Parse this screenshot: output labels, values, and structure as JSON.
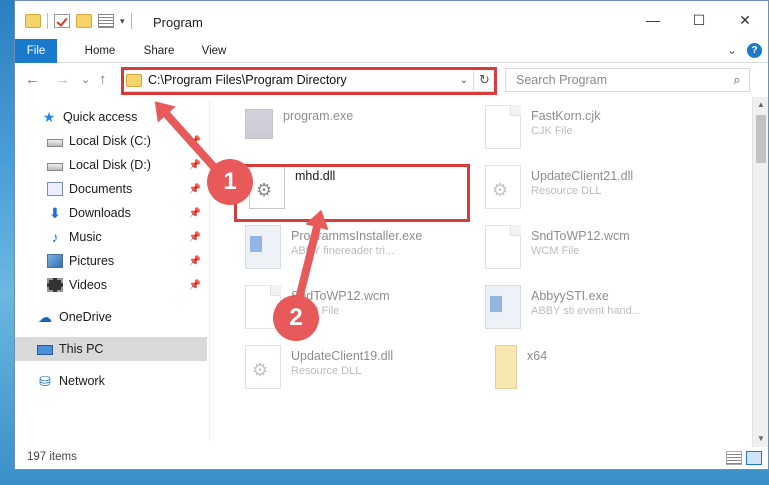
{
  "window": {
    "title": "Program",
    "minimize": "—",
    "maximize": "☐",
    "close": "✕"
  },
  "qat": {
    "dropdown": "▾"
  },
  "ribbon": {
    "tabs": [
      "File",
      "Home",
      "Share",
      "View"
    ],
    "expand": "⌄",
    "help": "?"
  },
  "nav": {
    "back": "←",
    "forward": "→",
    "recent": "⌄",
    "up": "↑",
    "address": "C:\\Program Files\\Program Directory",
    "address_dropdown": "⌄",
    "refresh": "↻",
    "search_placeholder": "Search Program",
    "search_icon": "⌕"
  },
  "sidebar": {
    "pin_glyph": "📌",
    "items": [
      {
        "label": "Quick access",
        "icon": "star-icon"
      },
      {
        "label": "Local Disk (C:)",
        "icon": "drive-icon"
      },
      {
        "label": "Local Disk (D:)",
        "icon": "drive-icon"
      },
      {
        "label": "Documents",
        "icon": "documents-icon"
      },
      {
        "label": "Downloads",
        "icon": "download-icon"
      },
      {
        "label": "Music",
        "icon": "music-icon"
      },
      {
        "label": "Pictures",
        "icon": "pictures-icon"
      },
      {
        "label": "Videos",
        "icon": "videos-icon"
      },
      {
        "label": "OneDrive",
        "icon": "cloud-icon"
      },
      {
        "label": "This PC",
        "icon": "computer-icon"
      },
      {
        "label": "Network",
        "icon": "network-icon"
      }
    ],
    "glyphs": {
      "star": "★",
      "down": "⬇",
      "music": "♪",
      "cloud": "☁",
      "net": "⛁"
    }
  },
  "files": [
    {
      "name": "program.exe",
      "type": ""
    },
    {
      "name": "FastKorn.cjk",
      "type": "CJK File"
    },
    {
      "name": "mhd.dll",
      "type": ""
    },
    {
      "name": "UpdateClient21.dll",
      "type": "Resource DLL"
    },
    {
      "name": "ProgrammsInstaller.exe",
      "type": "ABBY finereader tri..."
    },
    {
      "name": "SndToWP12.wcm",
      "type": "WCM File"
    },
    {
      "name": "SndToWP12.wcm",
      "type": "WCM File"
    },
    {
      "name": "AbbyySTI.exe",
      "type": "ABBY sti event hand..."
    },
    {
      "name": "UpdateClient19.dll",
      "type": "Resource DLL"
    },
    {
      "name": "x64",
      "type": ""
    }
  ],
  "scrollbar": {
    "up": "▲",
    "down": "▼"
  },
  "status": {
    "count": "197 items"
  },
  "annotations": {
    "badge1": "1",
    "badge2": "2"
  }
}
